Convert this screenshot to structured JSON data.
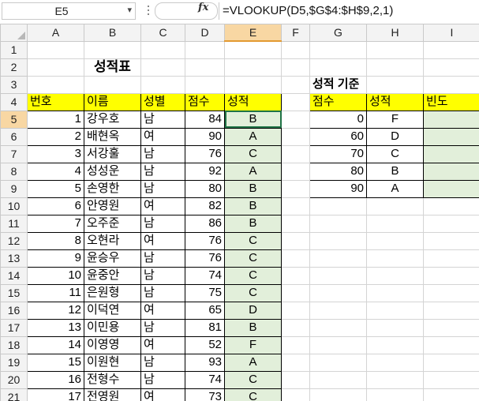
{
  "formula_bar": {
    "name_box": "E5",
    "name_box_dropdown": "▾",
    "fx_label": "fx",
    "formula": "=VLOOKUP(D5,$G$4:$H$9,2,1)"
  },
  "columns": [
    "A",
    "B",
    "C",
    "D",
    "E",
    "F",
    "G",
    "H",
    "I"
  ],
  "rows": [
    "1",
    "2",
    "3",
    "4",
    "5",
    "6",
    "7",
    "8",
    "9",
    "10",
    "11",
    "12",
    "13",
    "14",
    "15",
    "16",
    "17",
    "18",
    "19",
    "20",
    "21"
  ],
  "sheet": {
    "title": "성적표",
    "criteria_title": "성적 기준",
    "headers": {
      "no": "번호",
      "name": "이름",
      "gender": "성별",
      "score": "점수",
      "grade": "성적"
    },
    "criteria_headers": {
      "score": "점수",
      "grade": "성적",
      "freq": "빈도"
    },
    "students": [
      {
        "no": "1",
        "name": "강우호",
        "gender": "남",
        "score": "84",
        "grade": "B"
      },
      {
        "no": "2",
        "name": "배현옥",
        "gender": "여",
        "score": "90",
        "grade": "A"
      },
      {
        "no": "3",
        "name": "서강훌",
        "gender": "남",
        "score": "76",
        "grade": "C"
      },
      {
        "no": "4",
        "name": "성성운",
        "gender": "남",
        "score": "92",
        "grade": "A"
      },
      {
        "no": "5",
        "name": "손영한",
        "gender": "남",
        "score": "80",
        "grade": "B"
      },
      {
        "no": "6",
        "name": "안영원",
        "gender": "여",
        "score": "82",
        "grade": "B"
      },
      {
        "no": "7",
        "name": "오주준",
        "gender": "남",
        "score": "86",
        "grade": "B"
      },
      {
        "no": "8",
        "name": "오현라",
        "gender": "여",
        "score": "76",
        "grade": "C"
      },
      {
        "no": "9",
        "name": "윤승우",
        "gender": "남",
        "score": "76",
        "grade": "C"
      },
      {
        "no": "10",
        "name": "윤중안",
        "gender": "남",
        "score": "74",
        "grade": "C"
      },
      {
        "no": "11",
        "name": "은원형",
        "gender": "남",
        "score": "75",
        "grade": "C"
      },
      {
        "no": "12",
        "name": "이덕연",
        "gender": "여",
        "score": "65",
        "grade": "D"
      },
      {
        "no": "13",
        "name": "이민용",
        "gender": "남",
        "score": "81",
        "grade": "B"
      },
      {
        "no": "14",
        "name": "이영영",
        "gender": "여",
        "score": "52",
        "grade": "F"
      },
      {
        "no": "15",
        "name": "이원현",
        "gender": "남",
        "score": "93",
        "grade": "A"
      },
      {
        "no": "16",
        "name": "전형수",
        "gender": "남",
        "score": "74",
        "grade": "C"
      },
      {
        "no": "17",
        "name": "전영원",
        "gender": "여",
        "score": "73",
        "grade": "C"
      }
    ],
    "criteria": [
      {
        "score": "0",
        "grade": "F"
      },
      {
        "score": "60",
        "grade": "D"
      },
      {
        "score": "70",
        "grade": "C"
      },
      {
        "score": "80",
        "grade": "B"
      },
      {
        "score": "90",
        "grade": "A"
      }
    ]
  },
  "colors": {
    "header_yellow": "#ffff00",
    "result_green": "#e2efda",
    "selection_orange": "#f8d7a3",
    "active_border": "#217346"
  }
}
